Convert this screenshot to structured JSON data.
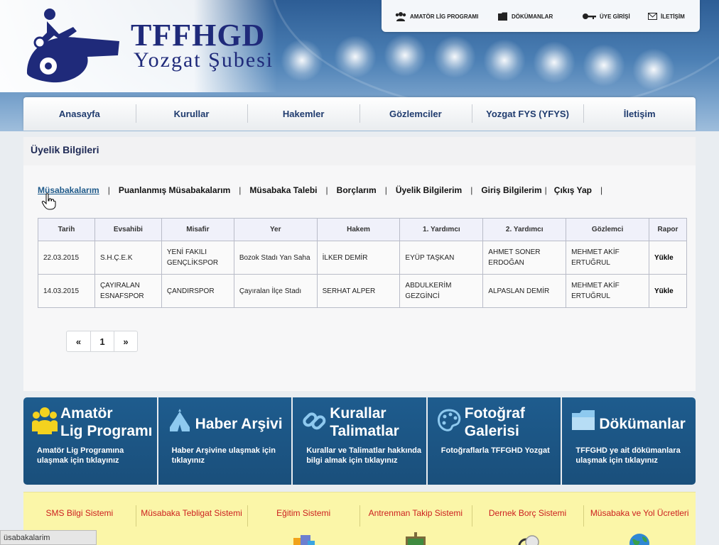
{
  "brand": {
    "name": "TFFHGD",
    "branch": "Yozgat Şubesi"
  },
  "topbar": [
    {
      "label": "AMATÖR LİG PROGRAMI",
      "icon": "users-icon"
    },
    {
      "label": "DÖKÜMANLAR",
      "icon": "folder-icon"
    },
    {
      "label": "ÜYE GİRİŞİ",
      "icon": "key-icon"
    },
    {
      "label": "İLETİŞİM",
      "icon": "envelope-icon"
    }
  ],
  "nav": [
    "Anasayfa",
    "Kurullar",
    "Hakemler",
    "Gözlemciler",
    "Yozgat FYS (YFYS)",
    "İletişim"
  ],
  "content": {
    "title": "Üyelik Bilgileri",
    "subnav": [
      "Müsabakalarım",
      "Puanlanmış Müsabakalarım",
      "Müsabaka Talebi",
      "Borçlarım",
      "Üyelik Bilgilerim",
      "Giriş Bilgilerim",
      "Çıkış Yap"
    ],
    "separator": "|",
    "table": {
      "headers": [
        "Tarih",
        "Evsahibi",
        "Misafir",
        "Yer",
        "Hakem",
        "1. Yardımcı",
        "2. Yardımcı",
        "Gözlemci",
        "Rapor"
      ],
      "rows": [
        [
          "22.03.2015",
          "S.H.Ç.E.K",
          "YENİ FAKILI GENÇLİKSPOR",
          "Bozok Stadı Yan Saha",
          "İLKER DEMİR",
          "EYÜP TAŞKAN",
          "AHMET SONER ERDOĞAN",
          "MEHMET AKİF ERTUĞRUL",
          "Yükle"
        ],
        [
          "14.03.2015",
          "ÇAYIRALAN ESNAFSPOR",
          "ÇANDIRSPOR",
          "Çayıralan İlçe Stadı",
          "SERHAT ALPER",
          "ABDULKERİM GEZGİNCİ",
          "ALPASLAN DEMİR",
          "MEHMET AKİF ERTUĞRUL",
          "Yükle"
        ]
      ]
    },
    "pager": {
      "prev": "«",
      "page": "1",
      "next": "»"
    }
  },
  "features": [
    {
      "title": "Amatör\nLig Programı",
      "desc": "Amatör Lig Programına ulaşmak için tıklayınız",
      "icon": "users-icon"
    },
    {
      "title": "Haber Arşivi",
      "desc": "Haber Arşivine ulaşmak için tıklayınız",
      "icon": "tent-icon"
    },
    {
      "title": "Kurallar\nTalimatlar",
      "desc": "Kurallar ve Talimatlar hakkında bilgi almak için tıklayınız",
      "icon": "link-icon"
    },
    {
      "title": "Fotoğraf\nGalerisi",
      "desc": "Fotoğraflarla TFFGHD Yozgat",
      "icon": "palette-icon"
    },
    {
      "title": "Dökümanlar",
      "desc": "TFFGHD ye ait dökümanlara ulaşmak için tıklayınız",
      "icon": "folder-icon"
    }
  ],
  "systems": [
    "SMS Bilgi Sistemi",
    "Müsabaka Tebligat Sistemi",
    "Eğitim Sistemi",
    "Antrenman Takip Sistemi",
    "Dernek Borç Sistemi",
    "Müsabaka ve Yol Ücretleri"
  ],
  "statusbar": "üsabakalarim",
  "colors": {
    "navText": "#1f3b6e",
    "featureBg": "#1e5c8e",
    "systemsBg": "#fbf6a8",
    "systemsText": "#cc1f1f",
    "brand": "#1f2a7a"
  }
}
